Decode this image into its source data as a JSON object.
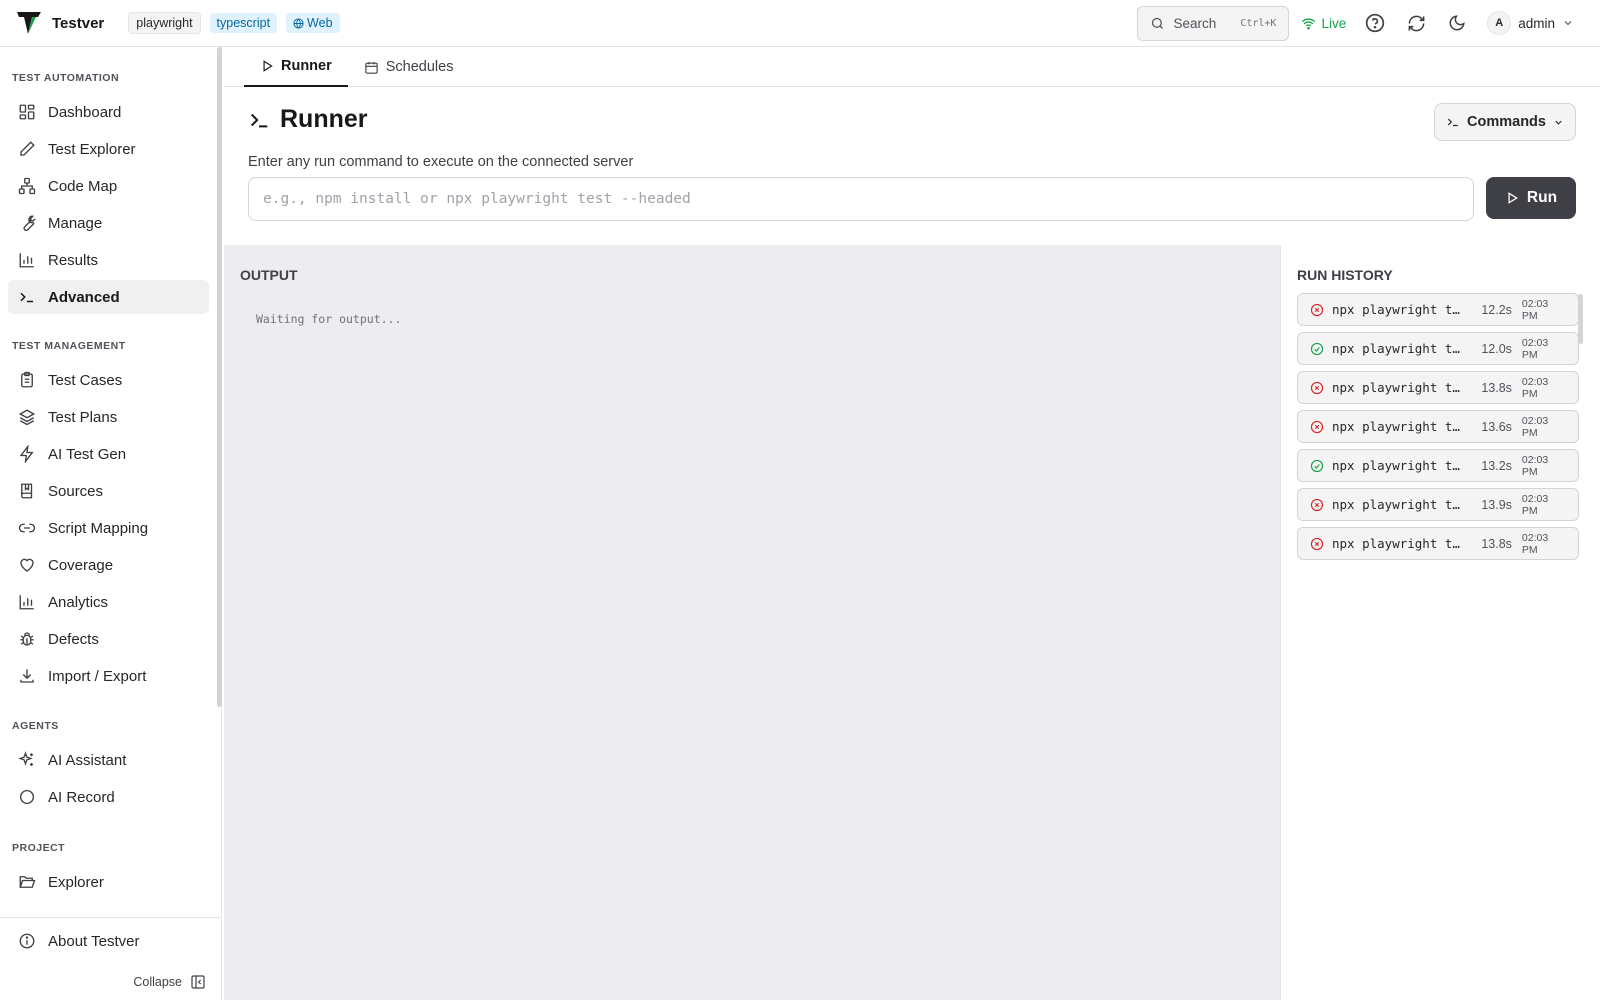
{
  "header": {
    "app_name": "Testver",
    "tags": [
      "playwright",
      "typescript",
      "Web"
    ],
    "search_label": "Search",
    "search_shortcut": "Ctrl+K",
    "live_label": "Live",
    "user_initial": "A",
    "user_name": "admin"
  },
  "sidebar": {
    "sections": [
      {
        "title": "TEST AUTOMATION",
        "items": [
          "Dashboard",
          "Test Explorer",
          "Code Map",
          "Manage",
          "Results",
          "Advanced"
        ]
      },
      {
        "title": "TEST MANAGEMENT",
        "items": [
          "Test Cases",
          "Test Plans",
          "AI Test Gen",
          "Sources",
          "Script Mapping",
          "Coverage",
          "Analytics",
          "Defects",
          "Import / Export"
        ]
      },
      {
        "title": "AGENTS",
        "items": [
          "AI Assistant",
          "AI Record"
        ]
      },
      {
        "title": "PROJECT",
        "items": [
          "Explorer"
        ]
      }
    ],
    "active_item": "Advanced",
    "about_label": "About Testver",
    "collapse_label": "Collapse"
  },
  "main": {
    "tabs": [
      "Runner",
      "Schedules"
    ],
    "active_tab": "Runner",
    "page_title": "Runner",
    "commands_label": "Commands",
    "description": "Enter any run command to execute on the connected server",
    "input_placeholder": "e.g., npm install or npx playwright test --headed",
    "input_value": "",
    "run_label": "Run",
    "output_label": "OUTPUT",
    "output_text": "Waiting for output...",
    "history_label": "RUN HISTORY",
    "history": [
      {
        "status": "failed",
        "command": "npx playwright test",
        "duration": "12.2s",
        "time": "02:03 PM"
      },
      {
        "status": "passed",
        "command": "npx playwright test",
        "duration": "12.0s",
        "time": "02:03 PM"
      },
      {
        "status": "failed",
        "command": "npx playwright test",
        "duration": "13.8s",
        "time": "02:03 PM"
      },
      {
        "status": "failed",
        "command": "npx playwright test",
        "duration": "13.6s",
        "time": "02:03 PM"
      },
      {
        "status": "passed",
        "command": "npx playwright test",
        "duration": "13.2s",
        "time": "02:03 PM"
      },
      {
        "status": "failed",
        "command": "npx playwright test",
        "duration": "13.9s",
        "time": "02:03 PM"
      },
      {
        "status": "failed",
        "command": "npx playwright test",
        "duration": "13.8s",
        "time": "02:03 PM"
      }
    ]
  },
  "colors": {
    "passed": "#16a34a",
    "failed": "#dc2626",
    "live": "#16a34a",
    "run_button": "#3f3f46"
  },
  "icons": {
    "nav": {
      "Dashboard": "dashboard-icon",
      "Test Explorer": "pencil-icon",
      "Code Map": "sitemap-icon",
      "Manage": "wrench-icon",
      "Results": "bar-chart-icon",
      "Advanced": "terminal-icon",
      "Test Cases": "clipboard-icon",
      "Test Plans": "layers-icon",
      "AI Test Gen": "bolt-icon",
      "Sources": "book-icon",
      "Script Mapping": "link-icon",
      "Coverage": "heart-icon",
      "Analytics": "bar-chart-icon",
      "Defects": "bug-icon",
      "Import / Export": "download-icon",
      "AI Assistant": "sparkles-icon",
      "AI Record": "circle-icon",
      "Explorer": "folder-open-icon"
    }
  }
}
